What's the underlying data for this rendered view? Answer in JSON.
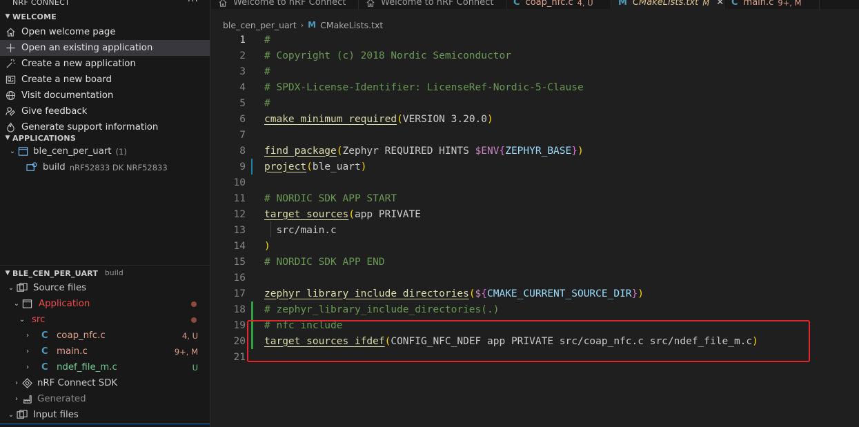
{
  "sidebar": {
    "header_title": "NRF CONNECT",
    "more_label": "···",
    "welcome": {
      "title": "WELCOME",
      "items": [
        {
          "label": "Open welcome page"
        },
        {
          "label": "Open an existing application"
        },
        {
          "label": "Create a new application"
        },
        {
          "label": "Create a new board"
        },
        {
          "label": "Visit documentation"
        },
        {
          "label": "Give feedback"
        },
        {
          "label": "Generate support information"
        }
      ]
    },
    "applications": {
      "title": "APPLICATIONS",
      "app_name": "ble_cen_per_uart",
      "app_count": "(1)",
      "build_label": "build",
      "build_board": "nRF52833 DK NRF52833"
    },
    "details": {
      "title": "BLE_CEN_PER_UART",
      "subtitle": "build",
      "source_files": "Source files",
      "application": "Application",
      "src": "src",
      "files": [
        {
          "icon": "C",
          "name": "coap_nfc.c",
          "badge": "4, U"
        },
        {
          "icon": "C",
          "name": "main.c",
          "badge": "9+, M"
        },
        {
          "icon": "C",
          "name": "ndef_file_m.c",
          "badge": "U"
        }
      ],
      "sdk": "nRF Connect SDK",
      "generated": "Generated",
      "input_files": "Input files"
    }
  },
  "tabs": [
    {
      "label": "Welcome to nRF Connect",
      "icon": "home-icon"
    },
    {
      "label": "Welcome to nRF Connect",
      "icon": "home-icon"
    },
    {
      "label": "coap_nfc.c",
      "status": "4, U",
      "icon": "c-file-icon"
    },
    {
      "label": "CMakeLists.txt",
      "status": "M",
      "icon": "cmake-file-icon",
      "close": "✕"
    },
    {
      "label": "main.c",
      "status": "9+, M",
      "icon": "c-file-icon"
    }
  ],
  "breadcrumb": {
    "folder": "ble_cen_per_uart",
    "file": "CMakeLists.txt",
    "sep": "›"
  },
  "code_lines": [
    "#",
    "# Copyright (c) 2018 Nordic Semiconductor",
    "#",
    "# SPDX-License-Identifier: LicenseRef-Nordic-5-Clause",
    "#",
    "cmake_minimum_required(VERSION 3.20.0)",
    "",
    "find_package(Zephyr REQUIRED HINTS $ENV{ZEPHYR_BASE})",
    "project(ble_uart)",
    "",
    "# NORDIC SDK APP START",
    "target_sources(app PRIVATE",
    "  src/main.c",
    ")",
    "# NORDIC SDK APP END",
    "",
    "zephyr_library_include_directories(${CMAKE_CURRENT_SOURCE_DIR})",
    "# zephyr_library_include_directories(.)",
    "# nfc include",
    "target_sources_ifdef(CONFIG_NFC_NDEF app PRIVATE src/coap_nfc.c src/ndef_file_m.c)",
    ""
  ],
  "colors": {
    "accent_blue": "#519aba",
    "modified": "#f14c4c",
    "untracked": "#73c991",
    "highlight_box": "#e0272b",
    "added_gutter": "#2ea043"
  }
}
